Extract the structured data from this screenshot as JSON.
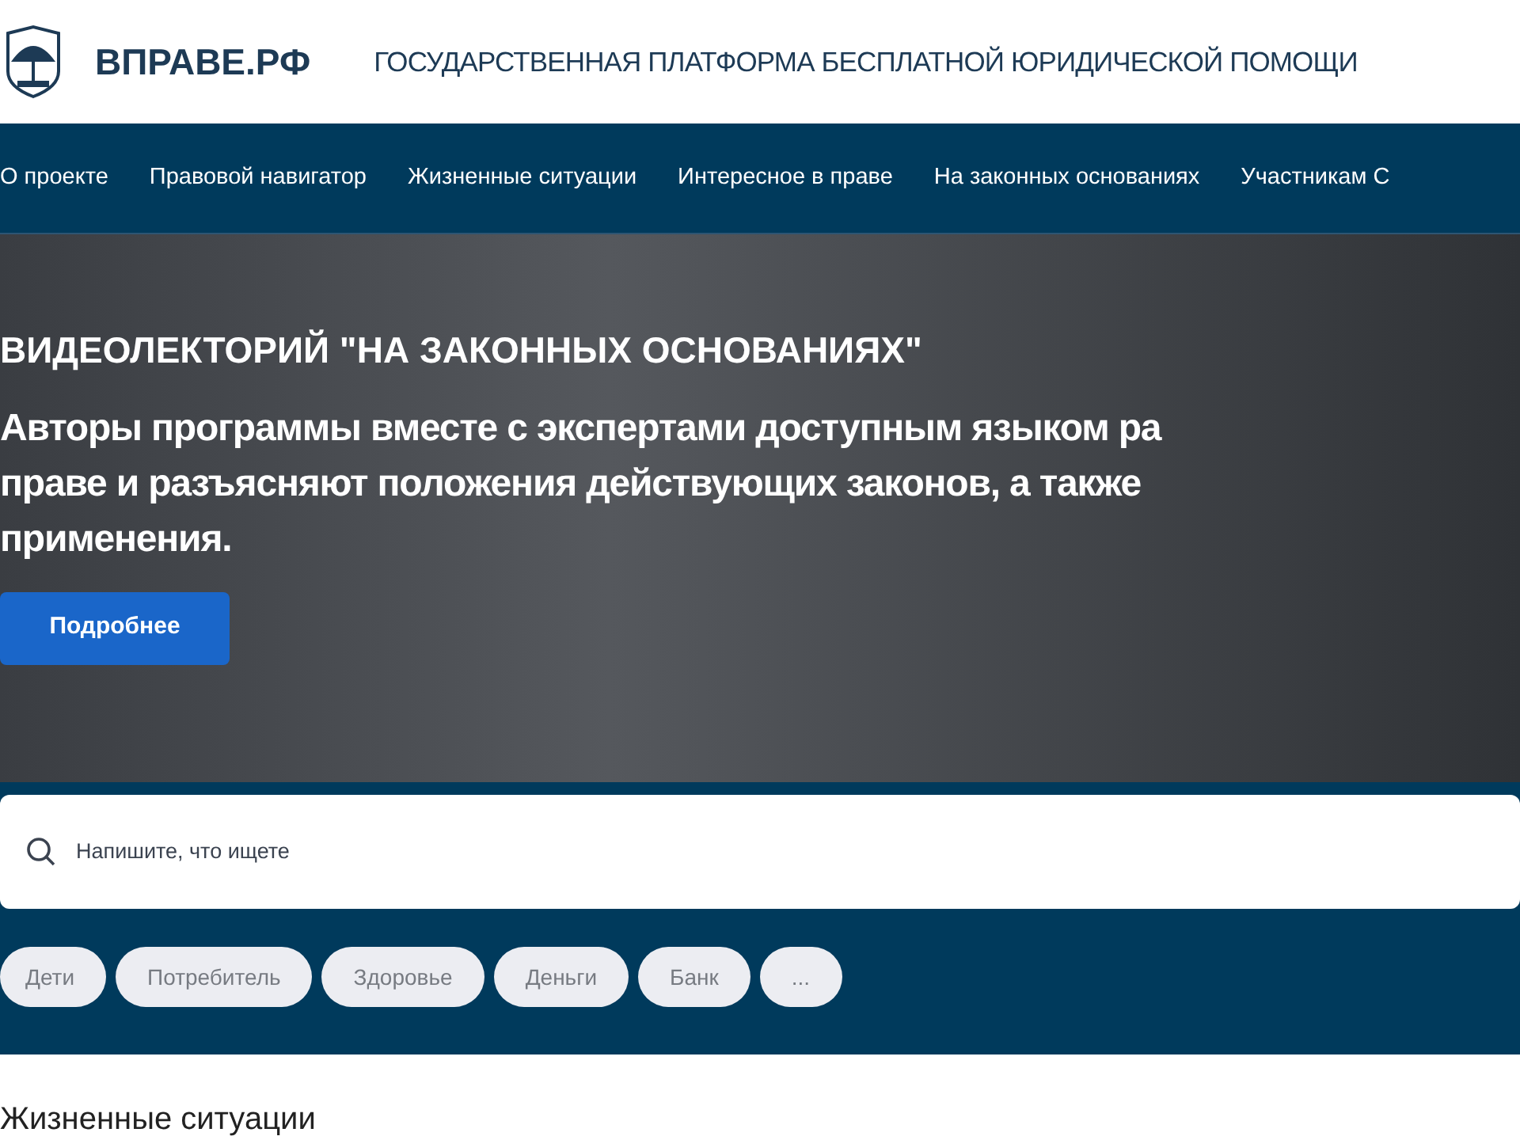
{
  "header": {
    "logo_text": "ВПРАВЕ.РФ",
    "tagline": "ГОСУДАРСТВЕННАЯ ПЛАТФОРМА БЕСПЛАТНОЙ ЮРИДИЧЕСКОЙ ПОМОЩИ"
  },
  "nav": [
    "О проекте",
    "Правовой навигатор",
    "Жизненные ситуации",
    "Интересное в праве",
    "На законных основаниях",
    "Участникам С"
  ],
  "hero": {
    "title": "ВИДЕОЛЕКТОРИЙ \"НА ЗАКОННЫХ ОСНОВАНИЯХ\"",
    "lines": [
      "Авторы программы вместе с экспертами доступным языком ра",
      "праве и разъясняют положения действующих законов, а также",
      "применения."
    ],
    "button": "Подробнее"
  },
  "search": {
    "placeholder": "Напишите, что ищете"
  },
  "tags": [
    "Дети",
    "Потребитель",
    "Здоровье",
    "Деньги",
    "Банк",
    "..."
  ],
  "section_title": "Жизненные ситуации"
}
